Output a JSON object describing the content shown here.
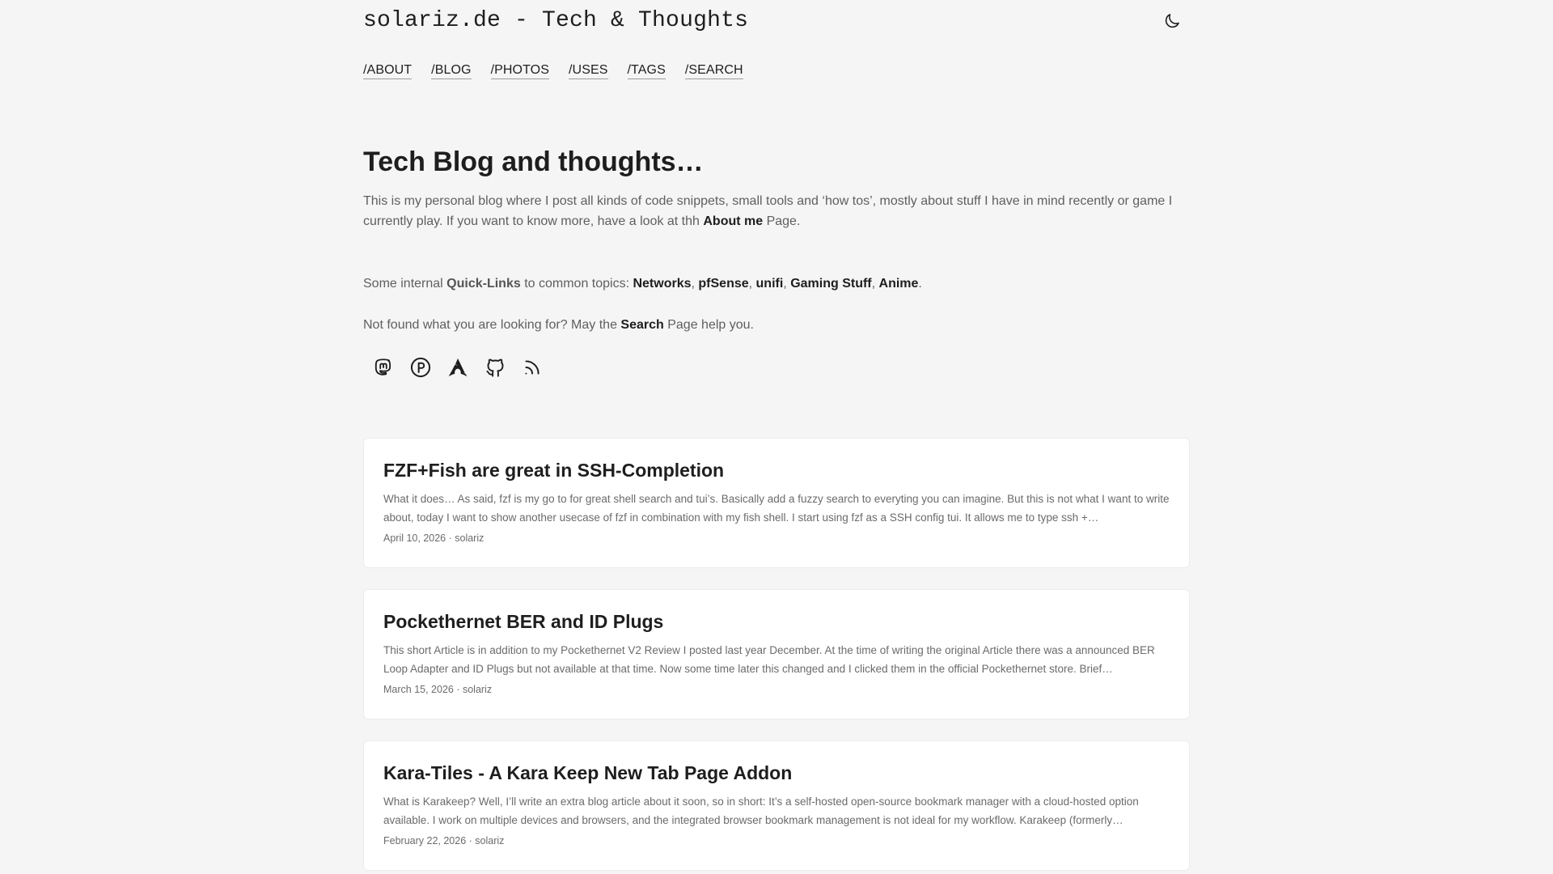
{
  "header": {
    "site_title": "solariz.de - Tech & Thoughts",
    "theme_toggle_icon": "moon-icon"
  },
  "nav": {
    "items": [
      "/ABOUT",
      "/BLOG",
      "/PHOTOS",
      "/USES",
      "/TAGS",
      "/SEARCH"
    ]
  },
  "intro": {
    "title": "Tech Blog and thoughts…",
    "p1_text": "This is my personal blog where I post all kinds of code snippets, small tools and ‘how tos’, mostly about stuff I have in mind recently or game I currently play. If you want to know more, have a look at thh ",
    "p1_link": "About me",
    "p1_end": " Page.",
    "p2_prefix": "Some internal ",
    "p2_quicklinks": "Quick-Links",
    "p2_mid": " to common topics: ",
    "topics": [
      "Networks",
      "pfSense",
      "unifi",
      "Gaming Stuff",
      "Anime"
    ],
    "topic_separator": ", ",
    "p2_end": ".",
    "p3_prefix": "Not found what you are looking for? May the ",
    "p3_link": "Search",
    "p3_end": " Page help you."
  },
  "social": [
    "mastodon-icon",
    "paypal-icon",
    "arch-linux-icon",
    "github-icon",
    "rss-icon"
  ],
  "posts": [
    {
      "title": "FZF+Fish are great in SSH-Completion",
      "summary": "What it does… As said, fzf is my go to for great shell search and tui’s. Basically add a fuzzy search to everyting you can imagine. But this is not what I want to write about, today I want to show another usecase of fzf in combination with my fish shell. I start using fzf as a SSH config tui. It allows me to type ssh +…",
      "meta": "April 10, 2026 · solariz"
    },
    {
      "title": "Pockethernet BER and ID Plugs",
      "summary": "This short Article is in addition to my Pockethernet V2 Review I posted last year December. At the time of writing the original Article there was a announced BER Loop Adapter and ID Plugs but not available at that time. Now some time later this changed and I clicked them in the official Pockethernet store. Brief…",
      "meta": "March 15, 2026 · solariz"
    },
    {
      "title": "Kara-Tiles - A Kara Keep New Tab Page Addon",
      "summary": "What is Karakeep? Well, I’ll write an extra blog article about it soon, so in short: It’s a self-hosted open-source bookmark manager with a cloud-hosted option available. I work on multiple devices and browsers, and the integrated browser bookmark management is not ideal for my workflow. Karakeep (formerly…",
      "meta": "February 22, 2026 · solariz"
    }
  ]
}
